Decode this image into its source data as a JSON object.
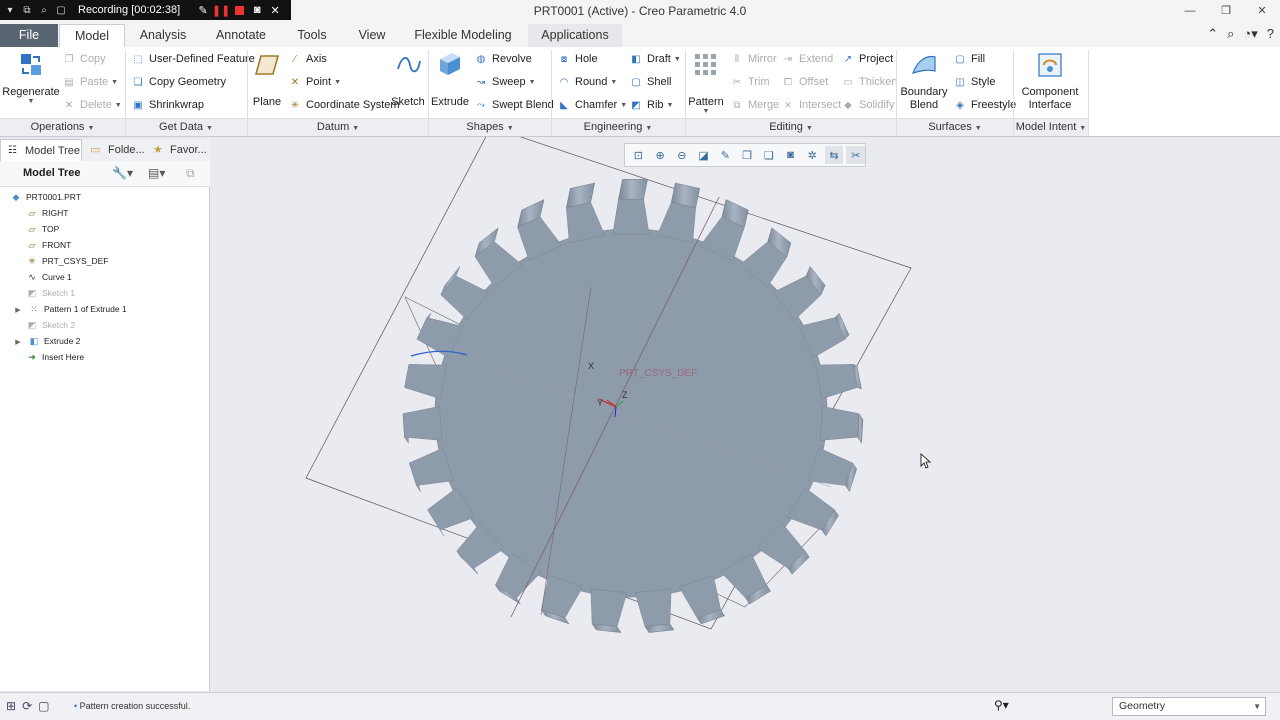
{
  "recorder": {
    "label": "Recording [00:02:38]"
  },
  "window": {
    "title": "PRT0001 (Active) - Creo Parametric 4.0"
  },
  "tabs": [
    "File",
    "Model",
    "Analysis",
    "Annotate",
    "Tools",
    "View",
    "Flexible Modeling",
    "Applications"
  ],
  "ribbon": {
    "operations": {
      "regenerate": "Regenerate",
      "copy": "Copy",
      "paste": "Paste",
      "delete": "Delete",
      "group": "Operations"
    },
    "get_data": {
      "user_defined_feature": "User-Defined Feature",
      "copy_geometry": "Copy Geometry",
      "shrinkwrap": "Shrinkwrap",
      "group": "Get Data"
    },
    "datum": {
      "plane": "Plane",
      "axis": "Axis",
      "point": "Point",
      "coordinate_system": "Coordinate System",
      "sketch": "Sketch",
      "group": "Datum"
    },
    "shapes": {
      "extrude": "Extrude",
      "revolve": "Revolve",
      "sweep": "Sweep",
      "swept_blend": "Swept Blend",
      "group": "Shapes"
    },
    "engineering": {
      "hole": "Hole",
      "round": "Round",
      "chamfer": "Chamfer",
      "draft": "Draft",
      "shell": "Shell",
      "rib": "Rib",
      "group": "Engineering"
    },
    "editing": {
      "pattern": "Pattern",
      "mirror": "Mirror",
      "trim": "Trim",
      "merge": "Merge",
      "extend": "Extend",
      "offset": "Offset",
      "intersect": "Intersect",
      "project": "Project",
      "thicken": "Thicken",
      "solidify": "Solidify",
      "group": "Editing"
    },
    "surfaces": {
      "boundary_blend": "Boundary\nBlend",
      "fill": "Fill",
      "style": "Style",
      "freestyle": "Freestyle",
      "group": "Surfaces"
    },
    "model_intent": {
      "component_interface": "Component\nInterface",
      "group": "Model Intent"
    }
  },
  "panel_tabs": [
    "Model Tree",
    "Folde...",
    "Favor..."
  ],
  "model_tree": {
    "title": "Model Tree",
    "nodes": [
      {
        "label": "PRT0001.PRT",
        "icon": "part-icon",
        "dim": false,
        "expand": false
      },
      {
        "label": "RIGHT",
        "icon": "datum-plane-icon",
        "dim": false,
        "expand": false
      },
      {
        "label": "TOP",
        "icon": "datum-plane-icon",
        "dim": false,
        "expand": false
      },
      {
        "label": "FRONT",
        "icon": "datum-plane-icon",
        "dim": false,
        "expand": false
      },
      {
        "label": "PRT_CSYS_DEF",
        "icon": "csys-icon",
        "dim": false,
        "expand": false
      },
      {
        "label": "Curve 1",
        "icon": "curve-icon",
        "dim": false,
        "expand": false
      },
      {
        "label": "Sketch 1",
        "icon": "sketch-icon",
        "dim": true,
        "expand": false
      },
      {
        "label": "Pattern 1 of Extrude 1",
        "icon": "pattern-icon",
        "dim": false,
        "expand": true
      },
      {
        "label": "Sketch 2",
        "icon": "sketch-icon",
        "dim": true,
        "expand": false
      },
      {
        "label": "Extrude 2",
        "icon": "extrude-icon",
        "dim": false,
        "expand": true
      },
      {
        "label": "Insert Here",
        "icon": "insert-arrow-icon",
        "dim": false,
        "expand": false
      }
    ]
  },
  "viewport": {
    "csys_label": "PRT_CSYS_DEF",
    "axis_x": "X",
    "axis_y": "Y",
    "axis_z": "Z",
    "gear_color": "#8e9bab"
  },
  "status": {
    "message": "Pattern creation successful.",
    "filter": "Geometry"
  }
}
